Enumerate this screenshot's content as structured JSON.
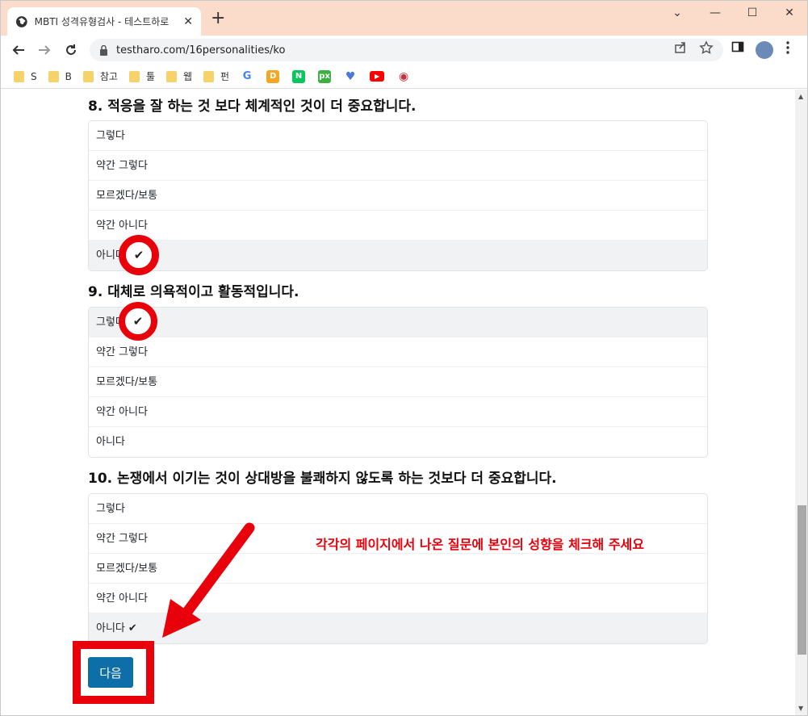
{
  "browser": {
    "tab_title": "MBTI 성격유형검사 - 테스트하로",
    "tab_close": "✕",
    "new_tab": "+",
    "url": "testharo.com/16personalities/ko",
    "window_controls": {
      "minimize": "⌄",
      "min": "—",
      "max": "☐",
      "close": "✕"
    }
  },
  "bookmarks": [
    {
      "label": "S",
      "type": "folder"
    },
    {
      "label": "B",
      "type": "folder"
    },
    {
      "label": "참고",
      "type": "folder"
    },
    {
      "label": "툴",
      "type": "folder"
    },
    {
      "label": "웹",
      "type": "folder"
    },
    {
      "label": "펀",
      "type": "folder"
    }
  ],
  "bookmark_icons": [
    {
      "label": "G",
      "color": "#4285f4",
      "icon": "google-icon"
    },
    {
      "label": "D",
      "color": "#f5a623",
      "icon": "daum-icon"
    },
    {
      "label": "N",
      "color": "#03c75a",
      "icon": "naver-icon"
    },
    {
      "label": "px",
      "color": "#3cb043",
      "icon": "pixabay-icon"
    },
    {
      "label": "♥",
      "color": "#4a7bd8",
      "icon": "heart-icon"
    },
    {
      "label": "▶",
      "color": "#ff0000",
      "icon": "youtube-icon"
    },
    {
      "label": "◉",
      "color": "#cd2e3a",
      "icon": "korea-flag-icon"
    }
  ],
  "questions": [
    {
      "number": "8.",
      "text": "적응을 잘 하는 것 보다 체계적인 것이 더 중요합니다.",
      "options": [
        "그렇다",
        "약간 그렇다",
        "모르겠다/보통",
        "약간 아니다",
        "아니다"
      ],
      "selected_index": 4
    },
    {
      "number": "9.",
      "text": "대체로 의욕적이고 활동적입니다.",
      "options": [
        "그렇다",
        "약간 그렇다",
        "모르겠다/보통",
        "약간 아니다",
        "아니다"
      ],
      "selected_index": 0
    },
    {
      "number": "10.",
      "text": "논쟁에서 이기는 것이 상대방을 불쾌하지 않도록 하는 것보다 더 중요합니다.",
      "options": [
        "그렇다",
        "약간 그렇다",
        "모르겠다/보통",
        "약간 아니다",
        "아니다"
      ],
      "selected_index": 4
    }
  ],
  "hint_text": "각각의 페이지에서 나온 질문에 본인의 성향을 체크해 주세요",
  "next_button_label": "다음",
  "check_glyph": "✔",
  "colors": {
    "accent_red": "#e8000b",
    "button_blue": "#0d6ea8",
    "titlebar": "#fbdccb"
  }
}
